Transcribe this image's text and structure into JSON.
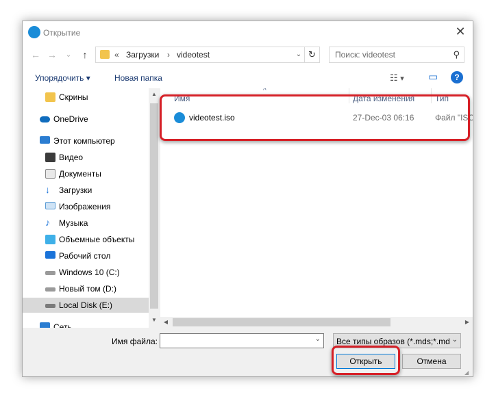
{
  "window": {
    "title": "Открытие",
    "close_glyph": "✕"
  },
  "nav": {
    "back_glyph": "←",
    "forward_glyph": "→",
    "recent_glyph": "⌄",
    "up_glyph": "↑",
    "address": {
      "prefix": "«",
      "segments": [
        "Загрузки",
        "videotest"
      ],
      "separator": "›",
      "dropdown_glyph": "⌄",
      "refresh_glyph": "↻"
    },
    "search": {
      "placeholder": "Поиск: videotest",
      "icon_glyph": "⚲"
    }
  },
  "toolbar": {
    "organize_label": "Упорядочить",
    "organize_arrow": "▾",
    "new_folder_label": "Новая папка",
    "view_glyph": "☷",
    "view_arrow": "▾",
    "preview_glyph": "▭",
    "help_glyph": "?"
  },
  "sidebar": {
    "items": [
      {
        "label": "Скрины",
        "icon": "folder-icon",
        "color": "#f2c44d"
      },
      {
        "label": "OneDrive",
        "icon": "cloud-icon",
        "color": "#0f6cbd"
      },
      {
        "label": "Этот компьютер",
        "icon": "computer-icon",
        "color": "#2b7dd1"
      },
      {
        "label": "Видео",
        "icon": "video-icon",
        "color": "#3b3b3b"
      },
      {
        "label": "Документы",
        "icon": "documents-icon",
        "color": "#8a8a8a"
      },
      {
        "label": "Загрузки",
        "icon": "downloads-icon",
        "color": "#1a73d9"
      },
      {
        "label": "Изображения",
        "icon": "images-icon",
        "color": "#5a9bd4"
      },
      {
        "label": "Музыка",
        "icon": "music-icon",
        "color": "#1a73d9"
      },
      {
        "label": "Объемные объекты",
        "icon": "3d-objects-icon",
        "color": "#3fb0e8"
      },
      {
        "label": "Рабочий стол",
        "icon": "desktop-icon",
        "color": "#1a73d9"
      },
      {
        "label": "Windows 10 (C:)",
        "icon": "drive-c-icon",
        "color": "#7a7a7a"
      },
      {
        "label": "Новый том (D:)",
        "icon": "drive-d-icon",
        "color": "#7a7a7a"
      },
      {
        "label": "Local Disk (E:)",
        "icon": "drive-e-icon",
        "color": "#7a7a7a"
      },
      {
        "label": "Сеть",
        "icon": "network-icon",
        "color": "#2b7dd1"
      }
    ],
    "selected_index": 12
  },
  "file_list": {
    "columns": [
      "Имя",
      "Дата изменения",
      "Тип"
    ],
    "sort_glyph": "^",
    "rows": [
      {
        "name": "videotest.iso",
        "date": "27-Dec-03 06:16",
        "type": "Файл \"ISO\""
      }
    ]
  },
  "bottom": {
    "filename_label": "Имя файла:",
    "filename_value": "",
    "filename_dropdown": "⌄",
    "filetype_value": "Все типы образов (*.mds;*.md",
    "filetype_dropdown": "⌄",
    "open_label": "Открыть",
    "cancel_label": "Отмена"
  },
  "scroll": {
    "up_glyph": "▲",
    "down_glyph": "▼",
    "left_glyph": "◀",
    "right_glyph": "▶"
  },
  "colors": {
    "highlight": "#d62027",
    "accent": "#0078d7",
    "link_text": "#1d3c73"
  }
}
